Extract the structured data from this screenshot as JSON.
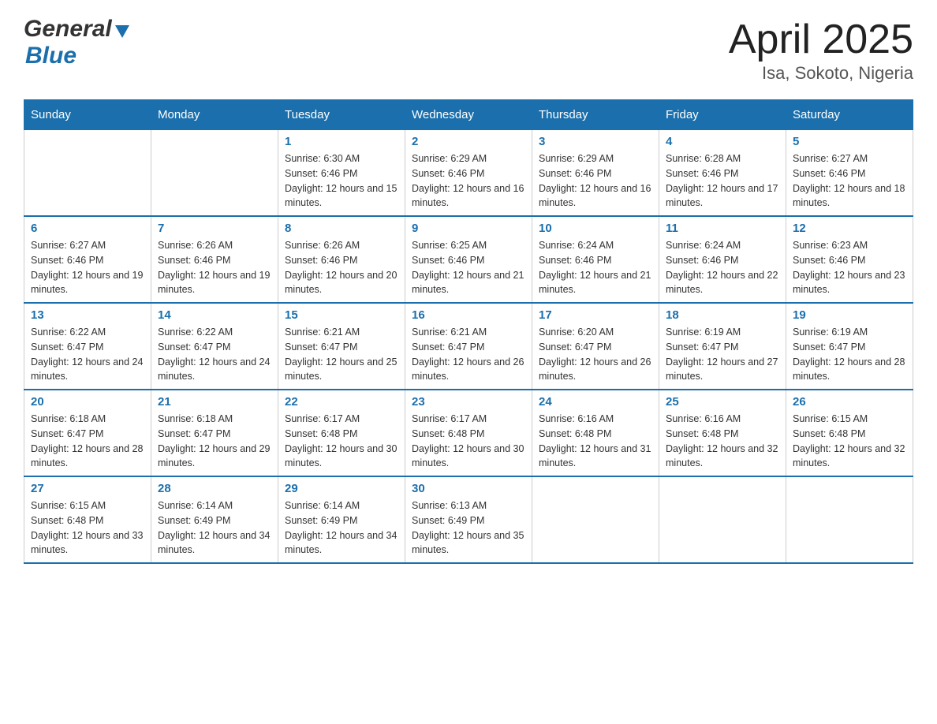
{
  "header": {
    "title": "April 2025",
    "subtitle": "Isa, Sokoto, Nigeria",
    "logo_general": "General",
    "logo_blue": "Blue"
  },
  "weekdays": [
    "Sunday",
    "Monday",
    "Tuesday",
    "Wednesday",
    "Thursday",
    "Friday",
    "Saturday"
  ],
  "weeks": [
    [
      {
        "day": "",
        "sunrise": "",
        "sunset": "",
        "daylight": ""
      },
      {
        "day": "",
        "sunrise": "",
        "sunset": "",
        "daylight": ""
      },
      {
        "day": "1",
        "sunrise": "Sunrise: 6:30 AM",
        "sunset": "Sunset: 6:46 PM",
        "daylight": "Daylight: 12 hours and 15 minutes."
      },
      {
        "day": "2",
        "sunrise": "Sunrise: 6:29 AM",
        "sunset": "Sunset: 6:46 PM",
        "daylight": "Daylight: 12 hours and 16 minutes."
      },
      {
        "day": "3",
        "sunrise": "Sunrise: 6:29 AM",
        "sunset": "Sunset: 6:46 PM",
        "daylight": "Daylight: 12 hours and 16 minutes."
      },
      {
        "day": "4",
        "sunrise": "Sunrise: 6:28 AM",
        "sunset": "Sunset: 6:46 PM",
        "daylight": "Daylight: 12 hours and 17 minutes."
      },
      {
        "day": "5",
        "sunrise": "Sunrise: 6:27 AM",
        "sunset": "Sunset: 6:46 PM",
        "daylight": "Daylight: 12 hours and 18 minutes."
      }
    ],
    [
      {
        "day": "6",
        "sunrise": "Sunrise: 6:27 AM",
        "sunset": "Sunset: 6:46 PM",
        "daylight": "Daylight: 12 hours and 19 minutes."
      },
      {
        "day": "7",
        "sunrise": "Sunrise: 6:26 AM",
        "sunset": "Sunset: 6:46 PM",
        "daylight": "Daylight: 12 hours and 19 minutes."
      },
      {
        "day": "8",
        "sunrise": "Sunrise: 6:26 AM",
        "sunset": "Sunset: 6:46 PM",
        "daylight": "Daylight: 12 hours and 20 minutes."
      },
      {
        "day": "9",
        "sunrise": "Sunrise: 6:25 AM",
        "sunset": "Sunset: 6:46 PM",
        "daylight": "Daylight: 12 hours and 21 minutes."
      },
      {
        "day": "10",
        "sunrise": "Sunrise: 6:24 AM",
        "sunset": "Sunset: 6:46 PM",
        "daylight": "Daylight: 12 hours and 21 minutes."
      },
      {
        "day": "11",
        "sunrise": "Sunrise: 6:24 AM",
        "sunset": "Sunset: 6:46 PM",
        "daylight": "Daylight: 12 hours and 22 minutes."
      },
      {
        "day": "12",
        "sunrise": "Sunrise: 6:23 AM",
        "sunset": "Sunset: 6:46 PM",
        "daylight": "Daylight: 12 hours and 23 minutes."
      }
    ],
    [
      {
        "day": "13",
        "sunrise": "Sunrise: 6:22 AM",
        "sunset": "Sunset: 6:47 PM",
        "daylight": "Daylight: 12 hours and 24 minutes."
      },
      {
        "day": "14",
        "sunrise": "Sunrise: 6:22 AM",
        "sunset": "Sunset: 6:47 PM",
        "daylight": "Daylight: 12 hours and 24 minutes."
      },
      {
        "day": "15",
        "sunrise": "Sunrise: 6:21 AM",
        "sunset": "Sunset: 6:47 PM",
        "daylight": "Daylight: 12 hours and 25 minutes."
      },
      {
        "day": "16",
        "sunrise": "Sunrise: 6:21 AM",
        "sunset": "Sunset: 6:47 PM",
        "daylight": "Daylight: 12 hours and 26 minutes."
      },
      {
        "day": "17",
        "sunrise": "Sunrise: 6:20 AM",
        "sunset": "Sunset: 6:47 PM",
        "daylight": "Daylight: 12 hours and 26 minutes."
      },
      {
        "day": "18",
        "sunrise": "Sunrise: 6:19 AM",
        "sunset": "Sunset: 6:47 PM",
        "daylight": "Daylight: 12 hours and 27 minutes."
      },
      {
        "day": "19",
        "sunrise": "Sunrise: 6:19 AM",
        "sunset": "Sunset: 6:47 PM",
        "daylight": "Daylight: 12 hours and 28 minutes."
      }
    ],
    [
      {
        "day": "20",
        "sunrise": "Sunrise: 6:18 AM",
        "sunset": "Sunset: 6:47 PM",
        "daylight": "Daylight: 12 hours and 28 minutes."
      },
      {
        "day": "21",
        "sunrise": "Sunrise: 6:18 AM",
        "sunset": "Sunset: 6:47 PM",
        "daylight": "Daylight: 12 hours and 29 minutes."
      },
      {
        "day": "22",
        "sunrise": "Sunrise: 6:17 AM",
        "sunset": "Sunset: 6:48 PM",
        "daylight": "Daylight: 12 hours and 30 minutes."
      },
      {
        "day": "23",
        "sunrise": "Sunrise: 6:17 AM",
        "sunset": "Sunset: 6:48 PM",
        "daylight": "Daylight: 12 hours and 30 minutes."
      },
      {
        "day": "24",
        "sunrise": "Sunrise: 6:16 AM",
        "sunset": "Sunset: 6:48 PM",
        "daylight": "Daylight: 12 hours and 31 minutes."
      },
      {
        "day": "25",
        "sunrise": "Sunrise: 6:16 AM",
        "sunset": "Sunset: 6:48 PM",
        "daylight": "Daylight: 12 hours and 32 minutes."
      },
      {
        "day": "26",
        "sunrise": "Sunrise: 6:15 AM",
        "sunset": "Sunset: 6:48 PM",
        "daylight": "Daylight: 12 hours and 32 minutes."
      }
    ],
    [
      {
        "day": "27",
        "sunrise": "Sunrise: 6:15 AM",
        "sunset": "Sunset: 6:48 PM",
        "daylight": "Daylight: 12 hours and 33 minutes."
      },
      {
        "day": "28",
        "sunrise": "Sunrise: 6:14 AM",
        "sunset": "Sunset: 6:49 PM",
        "daylight": "Daylight: 12 hours and 34 minutes."
      },
      {
        "day": "29",
        "sunrise": "Sunrise: 6:14 AM",
        "sunset": "Sunset: 6:49 PM",
        "daylight": "Daylight: 12 hours and 34 minutes."
      },
      {
        "day": "30",
        "sunrise": "Sunrise: 6:13 AM",
        "sunset": "Sunset: 6:49 PM",
        "daylight": "Daylight: 12 hours and 35 minutes."
      },
      {
        "day": "",
        "sunrise": "",
        "sunset": "",
        "daylight": ""
      },
      {
        "day": "",
        "sunrise": "",
        "sunset": "",
        "daylight": ""
      },
      {
        "day": "",
        "sunrise": "",
        "sunset": "",
        "daylight": ""
      }
    ]
  ]
}
